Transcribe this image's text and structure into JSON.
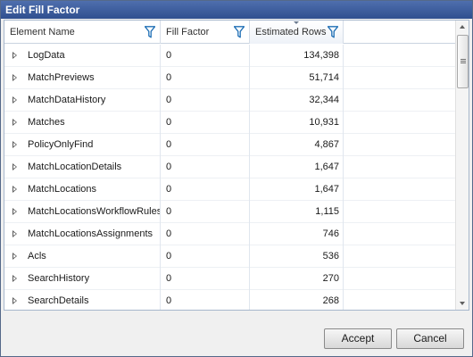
{
  "dialog": {
    "title": "Edit Fill Factor"
  },
  "grid": {
    "columns": [
      {
        "label": "Element Name",
        "filter_icon": "filter-icon"
      },
      {
        "label": "Fill Factor",
        "filter_icon": "filter-icon"
      },
      {
        "label": "Estimated Rows",
        "filter_icon": "filter-icon",
        "sorted": "descending"
      }
    ],
    "rows": [
      {
        "name": "LogData",
        "fill": "0",
        "est": "134,398"
      },
      {
        "name": "MatchPreviews",
        "fill": "0",
        "est": "51,714"
      },
      {
        "name": "MatchDataHistory",
        "fill": "0",
        "est": "32,344"
      },
      {
        "name": "Matches",
        "fill": "0",
        "est": "10,931"
      },
      {
        "name": "PolicyOnlyFind",
        "fill": "0",
        "est": "4,867"
      },
      {
        "name": "MatchLocationDetails",
        "fill": "0",
        "est": "1,647"
      },
      {
        "name": "MatchLocations",
        "fill": "0",
        "est": "1,647"
      },
      {
        "name": "MatchLocationsWorkflowRules",
        "fill": "0",
        "est": "1,115"
      },
      {
        "name": "MatchLocationsAssignments",
        "fill": "0",
        "est": "746"
      },
      {
        "name": "Acls",
        "fill": "0",
        "est": "536"
      },
      {
        "name": "SearchHistory",
        "fill": "0",
        "est": "270"
      },
      {
        "name": "SearchDetails",
        "fill": "0",
        "est": "268"
      }
    ]
  },
  "buttons": {
    "accept": "Accept",
    "cancel": "Cancel"
  },
  "colors": {
    "title_bar": "#3a5a9a",
    "grid_border": "#a7b7cc",
    "filter_icon": "#1f6fb5"
  }
}
